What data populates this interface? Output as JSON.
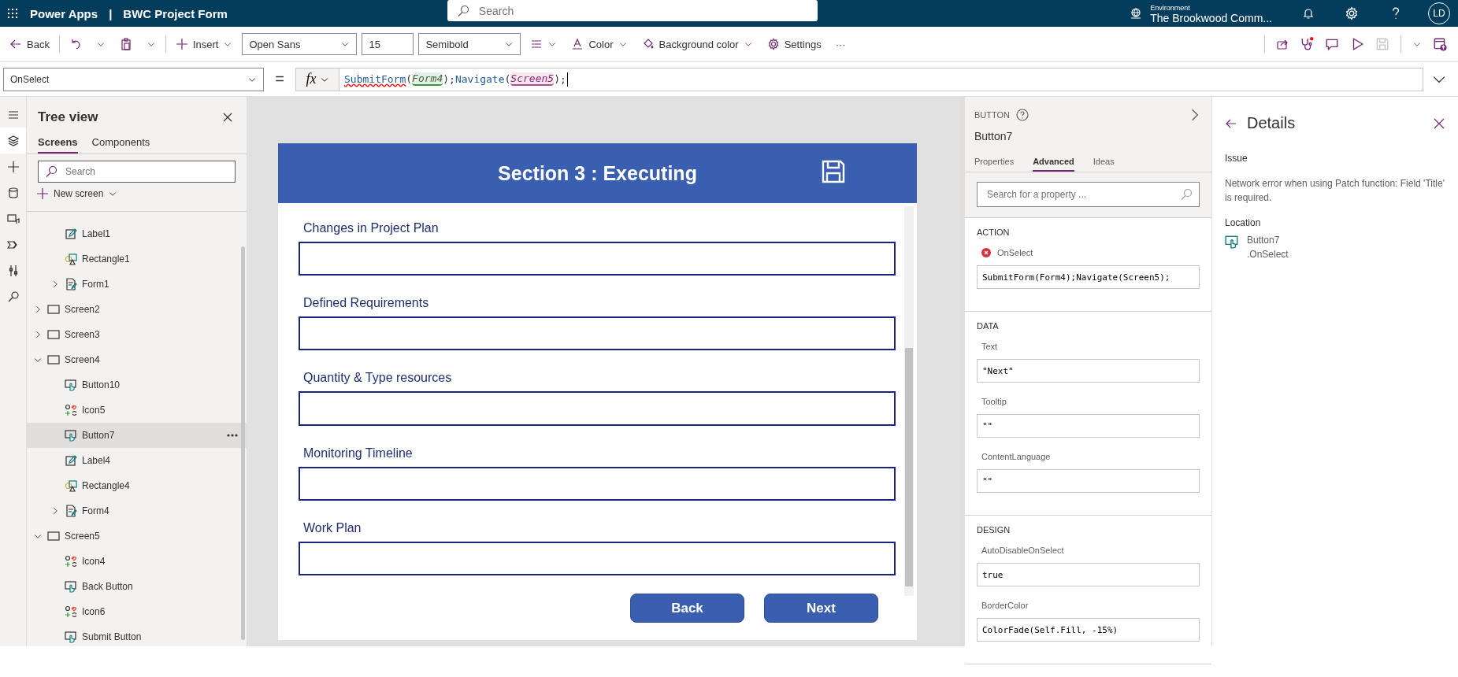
{
  "app_bar": {
    "app_name": "Power Apps",
    "separator": "|",
    "project": "BWC Project Form",
    "search_placeholder": "Search",
    "environment_label": "Environment",
    "environment": "The Brookwood Comm...",
    "avatar": "LD"
  },
  "toolbar": {
    "back": "Back",
    "insert": "Insert",
    "font": "Open Sans",
    "font_size": "15",
    "font_weight": "Semibold",
    "font_color": "Color",
    "background_color": "Background color",
    "settings": "Settings",
    "more": "···"
  },
  "formula_bar": {
    "property": "OnSelect",
    "equals": "=",
    "fx": "fx",
    "tokens": [
      {
        "text": "SubmitForm",
        "kind": "error_function"
      },
      {
        "text": "(",
        "kind": "punct"
      },
      {
        "text": "Form4",
        "kind": "control_ref"
      },
      {
        "text": ");",
        "kind": "punct"
      },
      {
        "text": "Navigate",
        "kind": "function"
      },
      {
        "text": "(",
        "kind": "punct"
      },
      {
        "text": "Screen5",
        "kind": "screen_ref"
      },
      {
        "text": ");",
        "kind": "punct"
      }
    ]
  },
  "rail": [
    {
      "kind": "menu",
      "selected": false
    },
    {
      "kind": "layers",
      "selected": true
    },
    {
      "kind": "insert",
      "selected": false
    },
    {
      "kind": "data",
      "selected": false
    },
    {
      "kind": "media",
      "selected": false
    },
    {
      "kind": "flows",
      "selected": false
    },
    {
      "kind": "tools",
      "selected": false
    },
    {
      "kind": "search",
      "selected": false
    }
  ],
  "tree_view": {
    "title": "Tree view",
    "tabs": [
      {
        "label": "Screens",
        "selected": true
      },
      {
        "label": "Components",
        "selected": false
      }
    ],
    "search_placeholder": "Search",
    "new_screen": "New screen",
    "items": [
      {
        "children": [
          {
            "label": "Label1",
            "kind": "label",
            "selected": false
          },
          {
            "label": "Rectangle1",
            "kind": "rectangle",
            "selected": false
          },
          {
            "label": "Form1",
            "kind": "form",
            "selected": false,
            "expanded": false
          }
        ]
      },
      {
        "label": "Screen2",
        "kind": "screen",
        "selected": false,
        "expanded": false
      },
      {
        "label": "Screen3",
        "kind": "screen",
        "selected": false,
        "expanded": false
      },
      {
        "label": "Screen4",
        "kind": "screen",
        "selected": false,
        "expanded": true,
        "children": [
          {
            "label": "Button10",
            "kind": "button",
            "selected": false
          },
          {
            "label": "Icon5",
            "kind": "icon",
            "selected": false
          },
          {
            "label": "Button7",
            "kind": "button",
            "selected": true
          },
          {
            "label": "Label4",
            "kind": "label",
            "selected": false
          },
          {
            "label": "Rectangle4",
            "kind": "rectangle",
            "selected": false
          },
          {
            "label": "Form4",
            "kind": "form",
            "selected": false,
            "expanded": false
          }
        ]
      },
      {
        "label": "Screen5",
        "kind": "screen",
        "selected": false,
        "expanded": true,
        "children": [
          {
            "label": "Icon4",
            "kind": "icon",
            "selected": false
          },
          {
            "label": "Back Button",
            "kind": "button",
            "selected": false
          },
          {
            "label": "Icon6",
            "kind": "icon",
            "selected": false
          },
          {
            "label": "Submit Button",
            "kind": "button",
            "selected": false
          }
        ]
      }
    ]
  },
  "canvas": {
    "header": "Section 3 : Executing",
    "fields": [
      {
        "label": "Changes in Project Plan"
      },
      {
        "label": "Defined Requirements"
      },
      {
        "label": "Quantity & Type resources"
      },
      {
        "label": "Monitoring Timeline"
      },
      {
        "label": "Work Plan"
      }
    ],
    "buttons": [
      {
        "label": "Back"
      },
      {
        "label": "Next"
      }
    ]
  },
  "properties": {
    "type_label": "BUTTON",
    "name": "Button7",
    "tabs": [
      {
        "label": "Properties",
        "selected": false
      },
      {
        "label": "Advanced",
        "selected": true
      },
      {
        "label": "Ideas",
        "selected": false
      }
    ],
    "search_placeholder": "Search for a property ...",
    "sections": [
      {
        "title": "ACTION",
        "props": [
          {
            "name": "OnSelect",
            "value": "SubmitForm(Form4);Navigate(Screen5);",
            "error": true
          }
        ]
      },
      {
        "title": "DATA",
        "props": [
          {
            "name": "Text",
            "value": "\"Next\"",
            "error": false
          },
          {
            "name": "Tooltip",
            "value": "\"\"",
            "error": false
          },
          {
            "name": "ContentLanguage",
            "value": "\"\"",
            "error": false
          }
        ]
      },
      {
        "title": "DESIGN",
        "props": [
          {
            "name": "AutoDisableOnSelect",
            "value": "true",
            "error": false
          },
          {
            "name": "BorderColor",
            "value": "ColorFade(Self.Fill, -15%)",
            "error": false
          }
        ]
      }
    ]
  },
  "details": {
    "title": "Details",
    "issue_label": "Issue",
    "issue": "Network error when using Patch function: Field 'Title' is required.",
    "location_label": "Location",
    "location_control": "Button7",
    "location_property": ".OnSelect"
  }
}
